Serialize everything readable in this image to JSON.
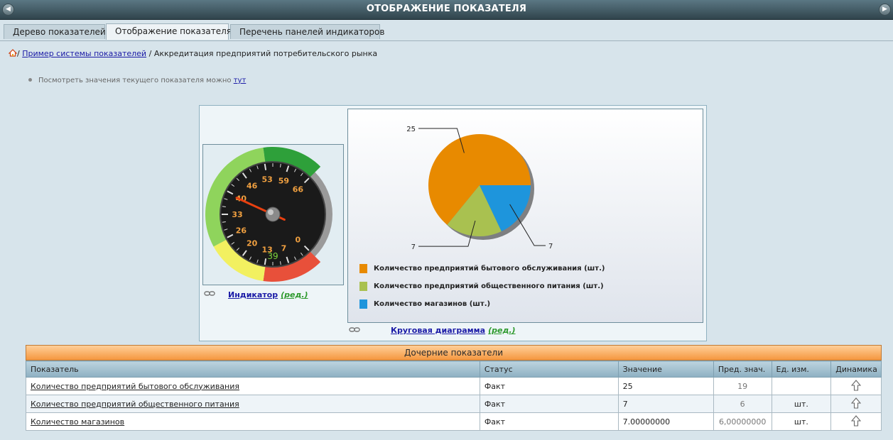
{
  "window": {
    "title": "Отображение показателя"
  },
  "tabs": [
    {
      "label": "Дерево показателей"
    },
    {
      "label": "Отображение показателя"
    },
    {
      "label": "Перечень панелей индикаторов"
    }
  ],
  "breadcrumb": {
    "sep": "/",
    "items": [
      "Пример системы показателей",
      "Аккредитация предприятий потребительского рынка"
    ]
  },
  "hint": {
    "text": "Посмотреть значения текущего показателя можно",
    "link": "тут"
  },
  "gauge": {
    "ticks": [
      "0",
      "7",
      "13",
      "20",
      "26",
      "33",
      "40",
      "46",
      "53",
      "59",
      "66"
    ],
    "min": 0,
    "max": 66,
    "value": 39,
    "value_label": "39",
    "zones": [
      {
        "from": 0,
        "to": 13,
        "color": "#e8503a"
      },
      {
        "from": 13,
        "to": 26,
        "color": "#f2f060"
      },
      {
        "from": 26,
        "to": 53,
        "color": "#8fd45c"
      },
      {
        "from": 53,
        "to": 66,
        "color": "#2ea03a"
      }
    ]
  },
  "indicator_panel": {
    "name": "Индикатор",
    "edit": "(ред.)"
  },
  "chart_data": {
    "type": "pie",
    "slices": [
      {
        "label": "Количество предприятий бытового обслуживания (шт.)",
        "value": 25,
        "value_label": "25",
        "color": "#e88a00"
      },
      {
        "label": "Количество предприятий общественного питания (шт.)",
        "value": 7,
        "value_label": "7",
        "color": "#a9c150"
      },
      {
        "label": "Количество магазинов (шт.)",
        "value": 7,
        "value_label": "7",
        "color": "#1e95dc"
      }
    ],
    "legend_position": "bottom-left"
  },
  "pie_panel": {
    "name": "Круговая диаграмма",
    "edit": "(ред.)"
  },
  "table": {
    "caption": "Дочерние показатели",
    "columns": [
      "Показатель",
      "Статус",
      "Значение",
      "Пред. знач.",
      "Ед. изм.",
      "Динамика"
    ],
    "rows": [
      {
        "name": "Количество предприятий бытового обслуживания",
        "status": "Факт",
        "value": "25",
        "prev": "19",
        "unit": "",
        "trend": "up"
      },
      {
        "name": "Количество предприятий общественного питания",
        "status": "Факт",
        "value": "7",
        "prev": "6",
        "unit": "шт.",
        "trend": "up"
      },
      {
        "name": "Количество магазинов",
        "status": "Факт",
        "value": "7.00000000",
        "prev": "6,00000000",
        "unit": "шт.",
        "trend": "up"
      }
    ]
  }
}
